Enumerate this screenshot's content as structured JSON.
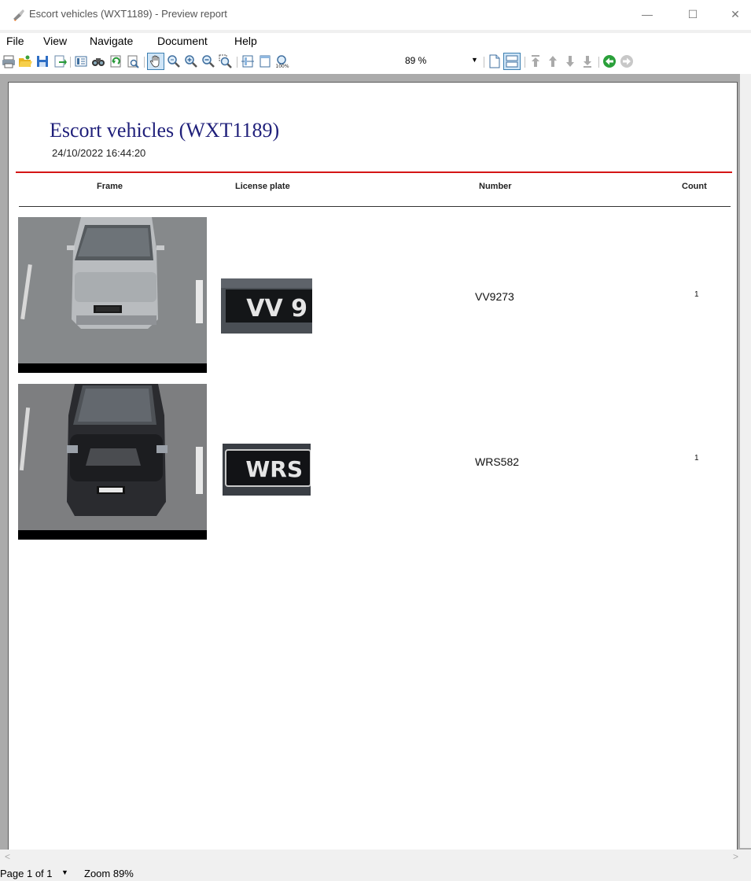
{
  "window": {
    "title": "Escort vehicles (WXT1189) - Preview report",
    "minimize_glyph": "—",
    "maximize_glyph": "☐",
    "close_glyph": "✕"
  },
  "menu": {
    "items": [
      "File",
      "View",
      "Navigate",
      "Document",
      "Help"
    ]
  },
  "toolbar": {
    "zoom_value": "89 %",
    "icons": [
      "print-icon",
      "open-icon",
      "save-icon",
      "export-icon",
      "page-setup-icon",
      "find-icon",
      "refresh-icon",
      "preview-icon",
      "hand-tool-icon",
      "zoom-icon",
      "zoom-in-icon",
      "zoom-out-icon",
      "zoom-rect-icon",
      "page-width-icon",
      "whole-page-icon",
      "zoom-100-icon",
      "single-page-icon",
      "multi-page-icon",
      "first-page-icon",
      "prev-page-icon",
      "next-page-icon",
      "last-page-icon",
      "back-icon",
      "forward-icon"
    ]
  },
  "report": {
    "title": "Escort vehicles (WXT1189)",
    "datetime": "24/10/2022 16:44:20",
    "columns": [
      "Frame",
      "License plate",
      "Number",
      "Count"
    ],
    "rows": [
      {
        "plate_text": "VV 9",
        "number": "VV9273",
        "count": "1"
      },
      {
        "plate_text": "WRS",
        "number": "WRS582",
        "count": "1"
      }
    ]
  },
  "status": {
    "page": "Page 1 of 1",
    "zoom": "Zoom 89%"
  },
  "colors": {
    "title_blue": "#1f1f7a",
    "rule_red": "#d41515",
    "page_bg": "#ffffff",
    "viewport_bg": "#ababab"
  }
}
